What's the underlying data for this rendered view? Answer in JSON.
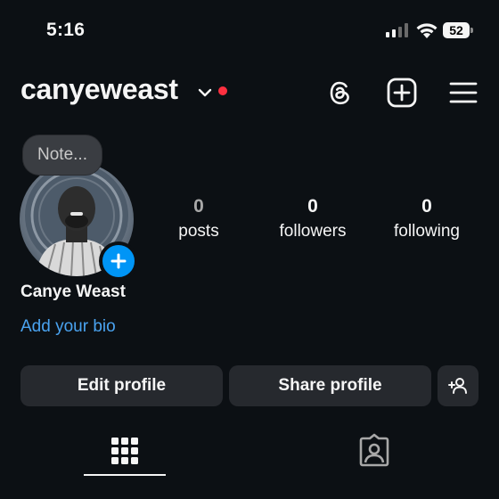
{
  "status_bar": {
    "time": "5:16",
    "battery": "52"
  },
  "header": {
    "username": "canyeweast"
  },
  "profile": {
    "note": "Note...",
    "display_name": "Canye Weast",
    "add_bio": "Add your bio",
    "stats": [
      {
        "value": "0",
        "label": "posts"
      },
      {
        "value": "0",
        "label": "followers"
      },
      {
        "value": "0",
        "label": "following"
      }
    ]
  },
  "buttons": {
    "edit": "Edit profile",
    "share": "Share profile"
  },
  "colors": {
    "background": "#0c1014",
    "accent": "#0095f6",
    "link": "#4aa3f0",
    "notification": "#ff3040",
    "button": "#26292e"
  },
  "icons": [
    "threads-icon",
    "new-post-icon",
    "menu-icon",
    "add-person-icon",
    "grid-icon",
    "tagged-icon",
    "chevron-down-icon"
  ]
}
